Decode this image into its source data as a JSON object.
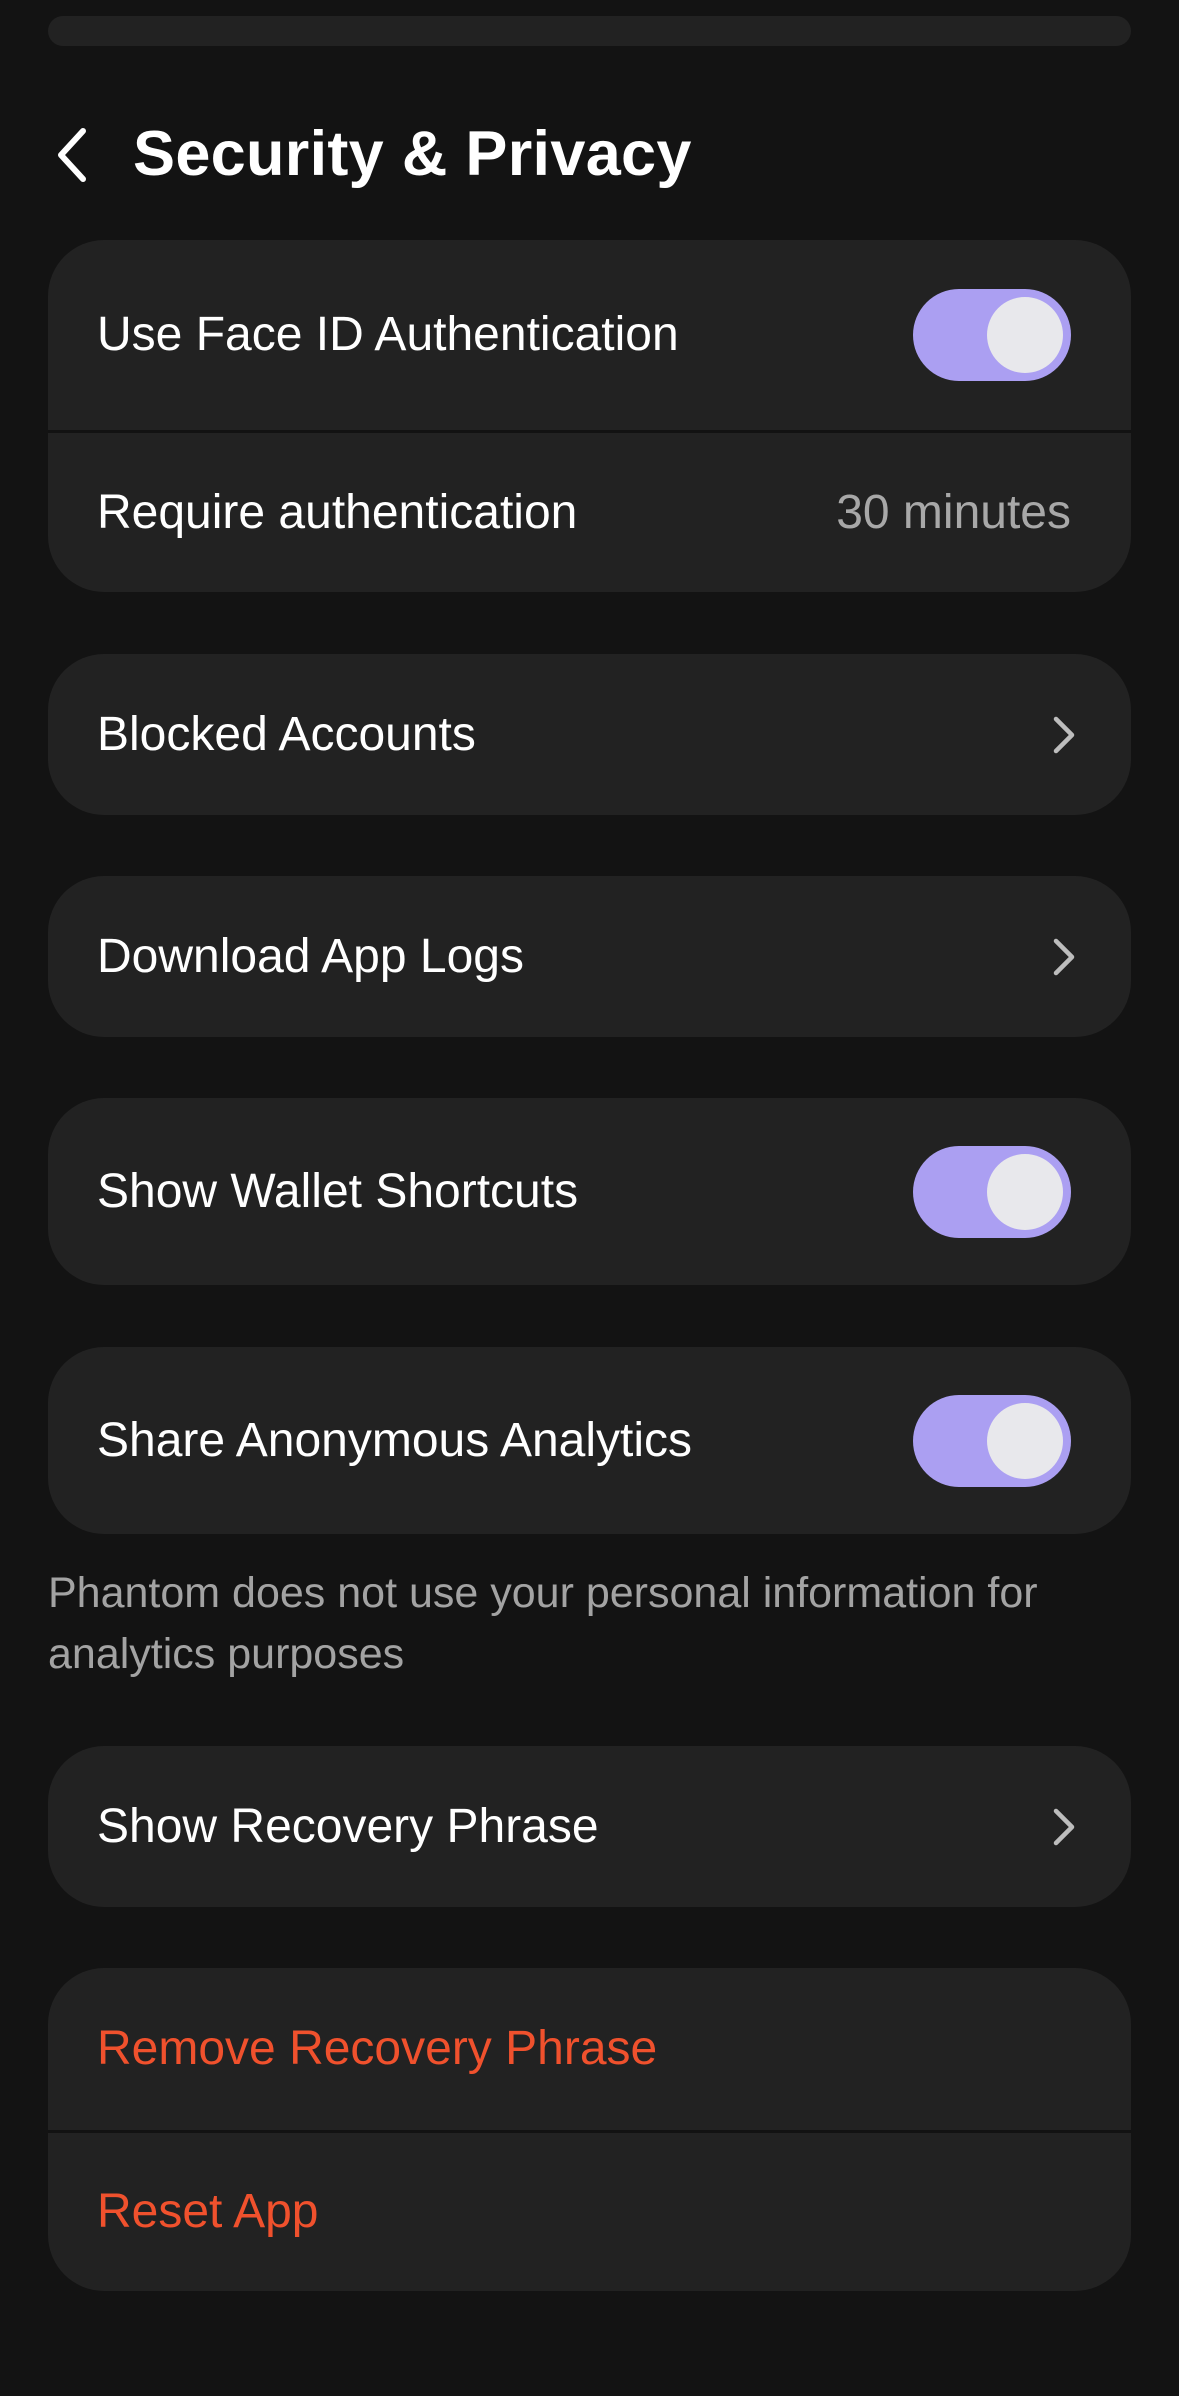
{
  "header": {
    "title": "Security & Privacy",
    "back_icon": "chevron-left-icon"
  },
  "auth_card": {
    "face_id": {
      "label": "Use Face ID Authentication",
      "enabled": true
    },
    "require_auth": {
      "label": "Require authentication",
      "value": "30 minutes"
    }
  },
  "blocked_accounts": {
    "label": "Blocked Accounts",
    "icon": "chevron-right-icon"
  },
  "download_logs": {
    "label": "Download App Logs",
    "icon": "chevron-right-icon"
  },
  "wallet_shortcuts": {
    "label": "Show Wallet Shortcuts",
    "enabled": true
  },
  "analytics": {
    "label": "Share Anonymous Analytics",
    "enabled": true,
    "footnote": "Phantom does not use your personal information for analytics purposes"
  },
  "recovery_phrase": {
    "label": "Show Recovery Phrase",
    "icon": "chevron-right-icon"
  },
  "danger_card": {
    "remove_phrase": {
      "label": "Remove Recovery Phrase"
    },
    "reset_app": {
      "label": "Reset App"
    }
  },
  "colors": {
    "background": "#131313",
    "card": "#222222",
    "accent": "#ab9ff2",
    "danger": "#f0512d",
    "secondary_text": "#a8a8a8"
  }
}
